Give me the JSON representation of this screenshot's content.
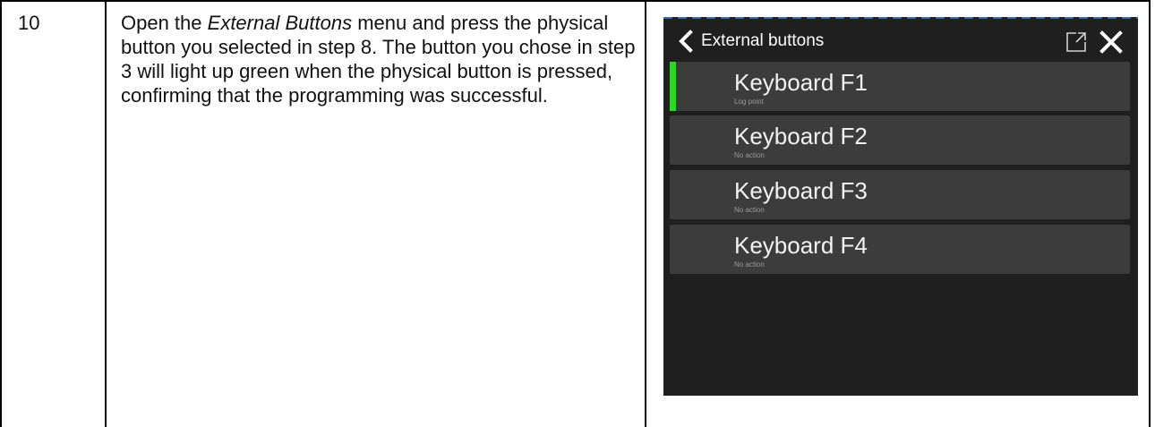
{
  "step": {
    "number": "10"
  },
  "instructions": {
    "part1": "Open the ",
    "menu_name": "External Buttons",
    "part2": " menu and press the physical button you selected in step 8. The button you chose in step 3 will light up green when the physical button is pressed, confirming that the programming was successful."
  },
  "screen": {
    "header_title": "External buttons",
    "items": [
      {
        "label": "Keyboard F1",
        "action": "Log point",
        "active": true
      },
      {
        "label": "Keyboard F2",
        "action": "No action",
        "active": false
      },
      {
        "label": "Keyboard F3",
        "action": "No action",
        "active": false
      },
      {
        "label": "Keyboard F4",
        "action": "No action",
        "active": false
      }
    ],
    "colors": {
      "active_indicator": "#2fd629",
      "background": "#1f1f1f",
      "item": "#3c3c3c"
    }
  }
}
